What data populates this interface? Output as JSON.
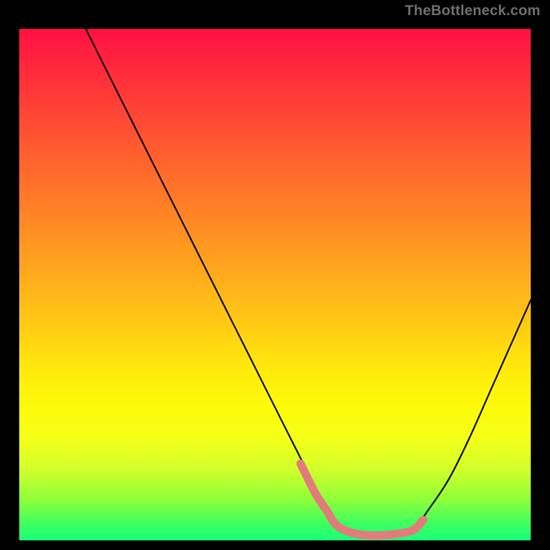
{
  "watermark": "TheBottleneck.com",
  "chart_data": {
    "type": "line",
    "title": "",
    "xlabel": "",
    "ylabel": "",
    "xlim": [
      0,
      100
    ],
    "ylim": [
      0,
      100
    ],
    "grid": false,
    "legend": false,
    "series": [
      {
        "name": "curve",
        "color": "#000000",
        "x": [
          13,
          16,
          20,
          24,
          28,
          32,
          36,
          40,
          44,
          48,
          52,
          56,
          58,
          60,
          62,
          65,
          68,
          71,
          74,
          77,
          80,
          84,
          88,
          92,
          96,
          100
        ],
        "y": [
          100,
          94,
          86,
          78,
          70,
          62,
          54,
          46,
          38,
          30,
          22,
          14,
          9,
          6,
          3,
          1.5,
          1,
          1,
          1.3,
          2,
          6,
          12,
          20,
          29,
          38,
          47
        ]
      },
      {
        "name": "highlight",
        "color": "#e27c7c",
        "x": [
          55,
          58,
          60,
          62,
          65,
          68,
          71,
          74,
          77,
          79
        ],
        "y": [
          15,
          9,
          6,
          3,
          1.5,
          1,
          1,
          1.3,
          2,
          4
        ]
      }
    ]
  }
}
